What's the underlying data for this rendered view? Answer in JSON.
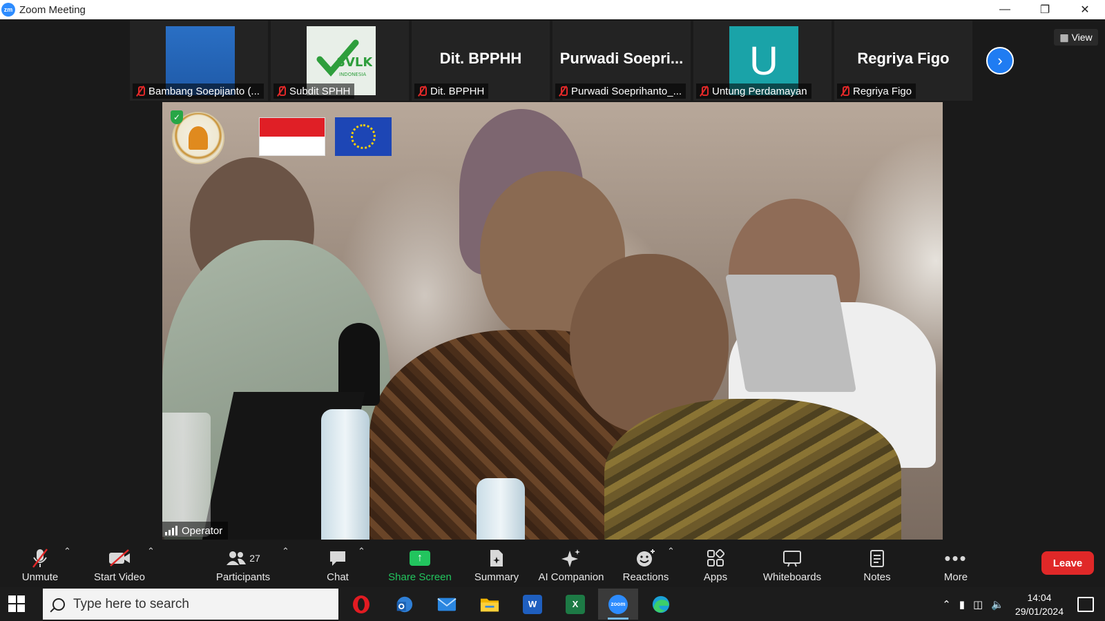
{
  "window": {
    "title": "Zoom Meeting",
    "logo": "zm"
  },
  "thumbnails": [
    {
      "caption": "Bambang Soepijanto (...",
      "type": "video-blue"
    },
    {
      "caption": "Subdit SPHH",
      "type": "svlk-logo",
      "logo_text": "SVLK",
      "logo_sub": "INDONESIA"
    },
    {
      "caption": "Dit. BPPHH",
      "type": "name",
      "big_name": "Dit. BPPHH"
    },
    {
      "caption": "Purwadi Soeprihanto_...",
      "type": "name",
      "big_name": "Purwadi  Soepri..."
    },
    {
      "caption": "Untung Perdamayan",
      "type": "avatar",
      "avatar_letter": "U"
    },
    {
      "caption": "Regriya Figo",
      "type": "name",
      "big_name": "Regriya Figo"
    }
  ],
  "view_button": "View",
  "main_video": {
    "speaker_label": "Operator"
  },
  "toolbar": {
    "unmute": "Unmute",
    "start_video": "Start Video",
    "participants": "Participants",
    "participants_count": "27",
    "chat": "Chat",
    "share_screen": "Share Screen",
    "summary": "Summary",
    "ai_companion": "AI Companion",
    "reactions": "Reactions",
    "apps": "Apps",
    "whiteboards": "Whiteboards",
    "notes": "Notes",
    "more": "More",
    "leave": "Leave"
  },
  "taskbar": {
    "search_placeholder": "Type here to search",
    "time": "14:04",
    "date": "29/01/2024",
    "apps": [
      "Opera",
      "Outlook",
      "Mail",
      "File Explorer",
      "Word",
      "Excel",
      "Zoom",
      "Edge"
    ],
    "zoom_label": "zoom"
  },
  "colors": {
    "leave": "#e02828",
    "share": "#22c55e",
    "zoom_blue": "#2d8cff",
    "next_button": "#1f7cf2"
  }
}
